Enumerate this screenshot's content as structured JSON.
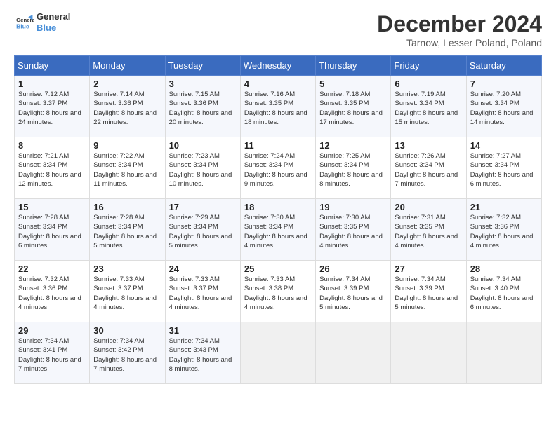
{
  "header": {
    "logo_line1": "General",
    "logo_line2": "Blue",
    "month_title": "December 2024",
    "location": "Tarnow, Lesser Poland, Poland"
  },
  "days_of_week": [
    "Sunday",
    "Monday",
    "Tuesday",
    "Wednesday",
    "Thursday",
    "Friday",
    "Saturday"
  ],
  "weeks": [
    [
      {
        "day": "1",
        "info": "Sunrise: 7:12 AM\nSunset: 3:37 PM\nDaylight: 8 hours and 24 minutes."
      },
      {
        "day": "2",
        "info": "Sunrise: 7:14 AM\nSunset: 3:36 PM\nDaylight: 8 hours and 22 minutes."
      },
      {
        "day": "3",
        "info": "Sunrise: 7:15 AM\nSunset: 3:36 PM\nDaylight: 8 hours and 20 minutes."
      },
      {
        "day": "4",
        "info": "Sunrise: 7:16 AM\nSunset: 3:35 PM\nDaylight: 8 hours and 18 minutes."
      },
      {
        "day": "5",
        "info": "Sunrise: 7:18 AM\nSunset: 3:35 PM\nDaylight: 8 hours and 17 minutes."
      },
      {
        "day": "6",
        "info": "Sunrise: 7:19 AM\nSunset: 3:34 PM\nDaylight: 8 hours and 15 minutes."
      },
      {
        "day": "7",
        "info": "Sunrise: 7:20 AM\nSunset: 3:34 PM\nDaylight: 8 hours and 14 minutes."
      }
    ],
    [
      {
        "day": "8",
        "info": "Sunrise: 7:21 AM\nSunset: 3:34 PM\nDaylight: 8 hours and 12 minutes."
      },
      {
        "day": "9",
        "info": "Sunrise: 7:22 AM\nSunset: 3:34 PM\nDaylight: 8 hours and 11 minutes."
      },
      {
        "day": "10",
        "info": "Sunrise: 7:23 AM\nSunset: 3:34 PM\nDaylight: 8 hours and 10 minutes."
      },
      {
        "day": "11",
        "info": "Sunrise: 7:24 AM\nSunset: 3:34 PM\nDaylight: 8 hours and 9 minutes."
      },
      {
        "day": "12",
        "info": "Sunrise: 7:25 AM\nSunset: 3:34 PM\nDaylight: 8 hours and 8 minutes."
      },
      {
        "day": "13",
        "info": "Sunrise: 7:26 AM\nSunset: 3:34 PM\nDaylight: 8 hours and 7 minutes."
      },
      {
        "day": "14",
        "info": "Sunrise: 7:27 AM\nSunset: 3:34 PM\nDaylight: 8 hours and 6 minutes."
      }
    ],
    [
      {
        "day": "15",
        "info": "Sunrise: 7:28 AM\nSunset: 3:34 PM\nDaylight: 8 hours and 6 minutes."
      },
      {
        "day": "16",
        "info": "Sunrise: 7:28 AM\nSunset: 3:34 PM\nDaylight: 8 hours and 5 minutes."
      },
      {
        "day": "17",
        "info": "Sunrise: 7:29 AM\nSunset: 3:34 PM\nDaylight: 8 hours and 5 minutes."
      },
      {
        "day": "18",
        "info": "Sunrise: 7:30 AM\nSunset: 3:34 PM\nDaylight: 8 hours and 4 minutes."
      },
      {
        "day": "19",
        "info": "Sunrise: 7:30 AM\nSunset: 3:35 PM\nDaylight: 8 hours and 4 minutes."
      },
      {
        "day": "20",
        "info": "Sunrise: 7:31 AM\nSunset: 3:35 PM\nDaylight: 8 hours and 4 minutes."
      },
      {
        "day": "21",
        "info": "Sunrise: 7:32 AM\nSunset: 3:36 PM\nDaylight: 8 hours and 4 minutes."
      }
    ],
    [
      {
        "day": "22",
        "info": "Sunrise: 7:32 AM\nSunset: 3:36 PM\nDaylight: 8 hours and 4 minutes."
      },
      {
        "day": "23",
        "info": "Sunrise: 7:33 AM\nSunset: 3:37 PM\nDaylight: 8 hours and 4 minutes."
      },
      {
        "day": "24",
        "info": "Sunrise: 7:33 AM\nSunset: 3:37 PM\nDaylight: 8 hours and 4 minutes."
      },
      {
        "day": "25",
        "info": "Sunrise: 7:33 AM\nSunset: 3:38 PM\nDaylight: 8 hours and 4 minutes."
      },
      {
        "day": "26",
        "info": "Sunrise: 7:34 AM\nSunset: 3:39 PM\nDaylight: 8 hours and 5 minutes."
      },
      {
        "day": "27",
        "info": "Sunrise: 7:34 AM\nSunset: 3:39 PM\nDaylight: 8 hours and 5 minutes."
      },
      {
        "day": "28",
        "info": "Sunrise: 7:34 AM\nSunset: 3:40 PM\nDaylight: 8 hours and 6 minutes."
      }
    ],
    [
      {
        "day": "29",
        "info": "Sunrise: 7:34 AM\nSunset: 3:41 PM\nDaylight: 8 hours and 7 minutes."
      },
      {
        "day": "30",
        "info": "Sunrise: 7:34 AM\nSunset: 3:42 PM\nDaylight: 8 hours and 7 minutes."
      },
      {
        "day": "31",
        "info": "Sunrise: 7:34 AM\nSunset: 3:43 PM\nDaylight: 8 hours and 8 minutes."
      },
      null,
      null,
      null,
      null
    ]
  ]
}
